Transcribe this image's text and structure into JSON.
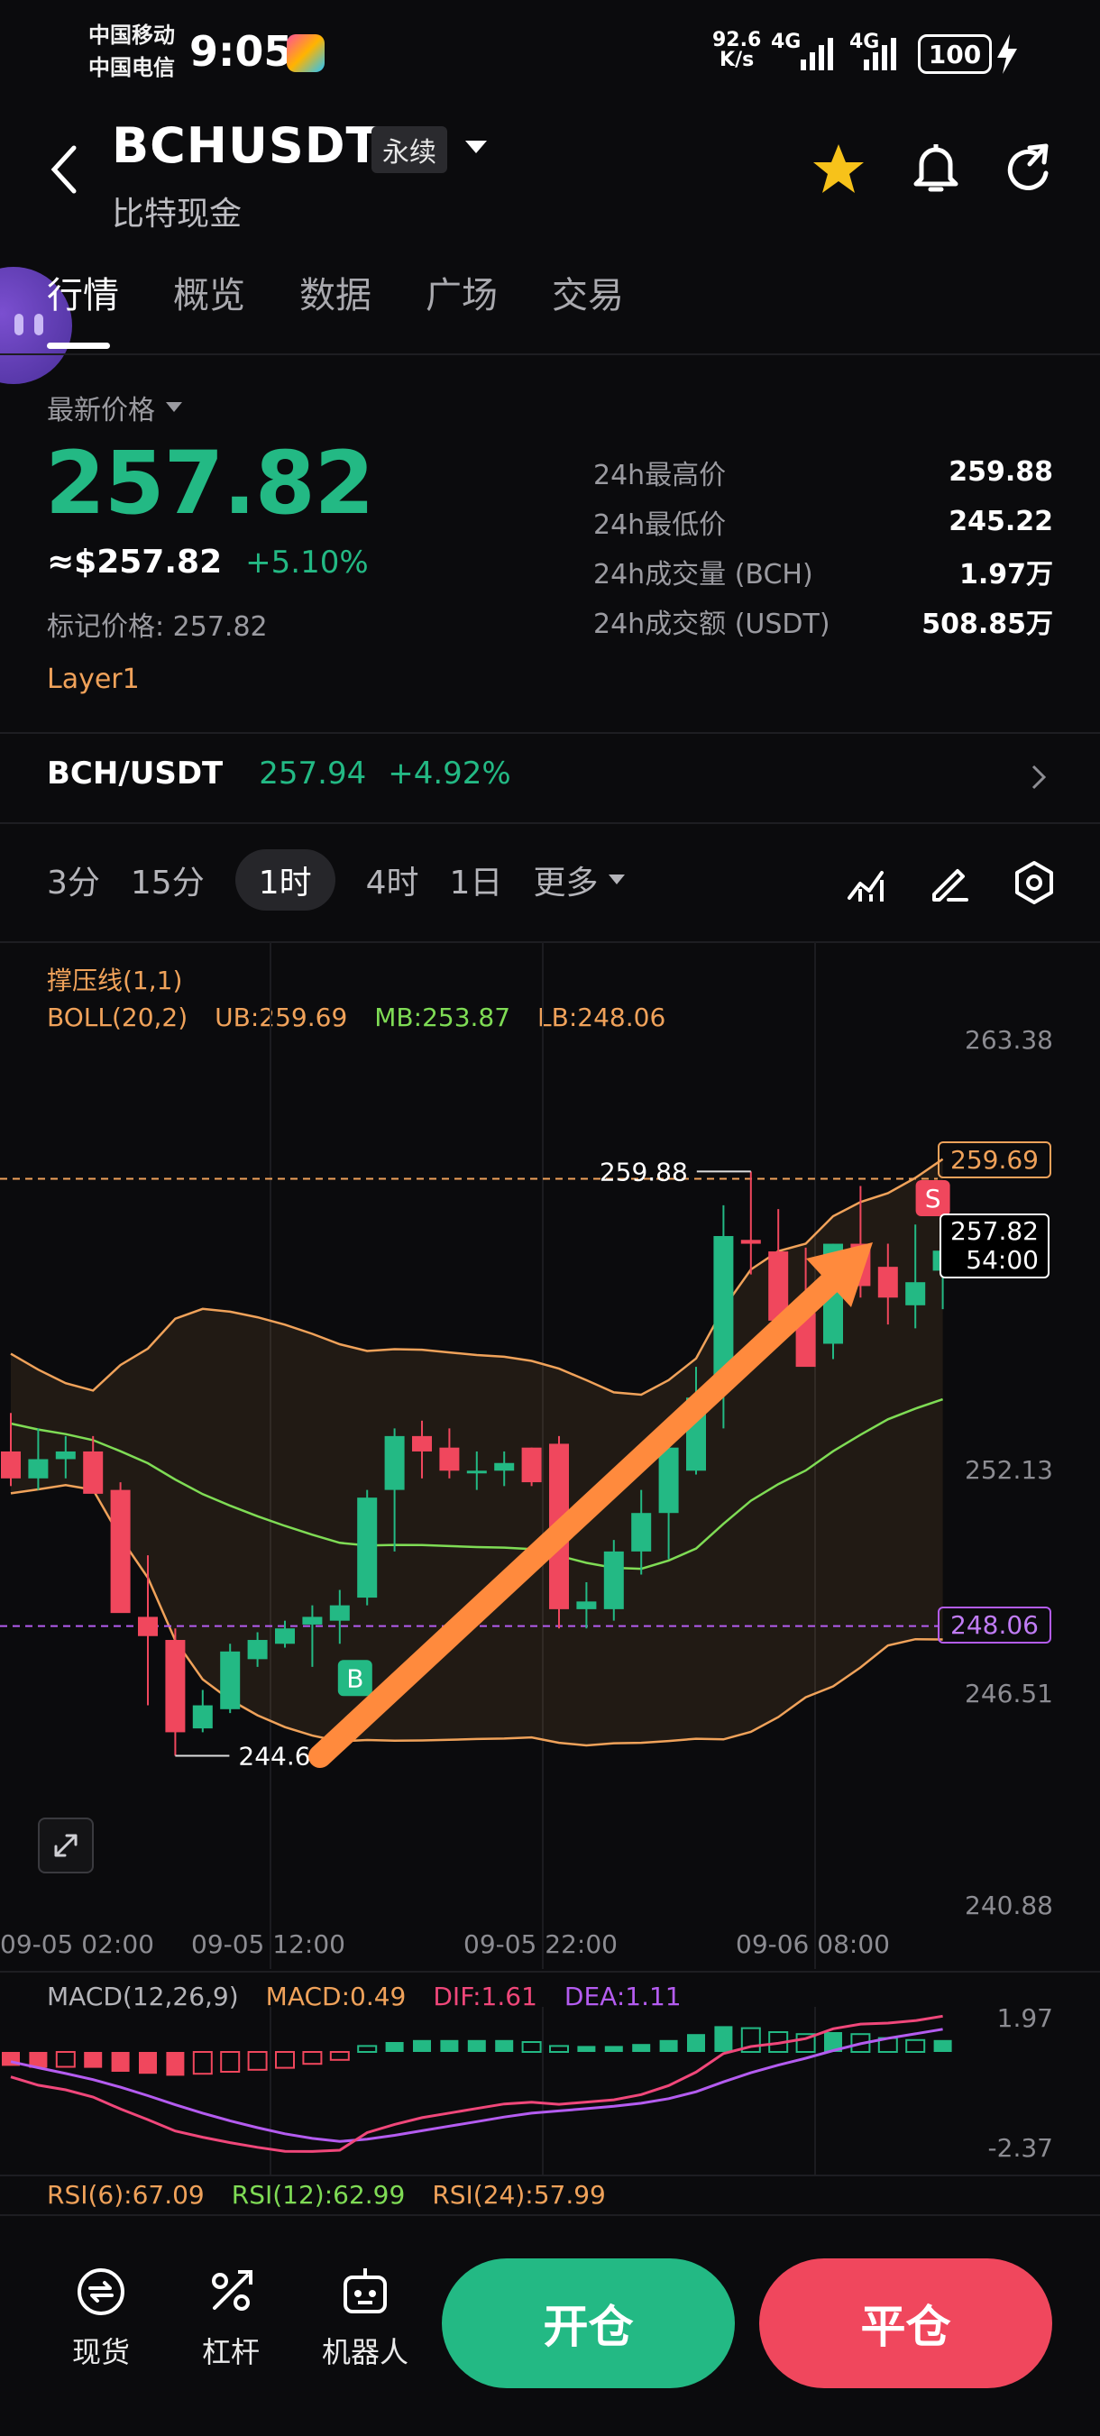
{
  "status_bar": {
    "carrier_1": "中国移动",
    "carrier_2": "中国电信",
    "time": "9:05",
    "net_speed_value": "92.6",
    "net_speed_unit": "K/s",
    "signal_1": "4G",
    "signal_2": "4G",
    "battery": "100"
  },
  "header": {
    "symbol": "BCHUSDT",
    "contract_type": "永续",
    "name": "比特现金"
  },
  "tabs": [
    {
      "label": "行情"
    },
    {
      "label": "概览"
    },
    {
      "label": "数据"
    },
    {
      "label": "广场"
    },
    {
      "label": "交易"
    }
  ],
  "price": {
    "label": "最新价格",
    "last": "257.82",
    "usd": "≈$257.82",
    "change": "+5.10%",
    "mark": "标记价格: 257.82",
    "tag": "Layer1"
  },
  "stats": [
    {
      "label": "24h最高价",
      "value": "259.88"
    },
    {
      "label": "24h最低价",
      "value": "245.22"
    },
    {
      "label": "24h成交量 (BCH)",
      "value": "1.97万"
    },
    {
      "label": "24h成交额 (USDT)",
      "value": "508.85万"
    }
  ],
  "spot": {
    "pair": "BCH/USDT",
    "price": "257.94",
    "change": "+4.92%"
  },
  "timeframes": [
    {
      "label": "3分"
    },
    {
      "label": "15分"
    },
    {
      "label": "1时"
    },
    {
      "label": "4时"
    },
    {
      "label": "1日"
    }
  ],
  "more_label": "更多",
  "indicators": {
    "sr_line": "撑压线(1,1)",
    "boll": "BOLL(20,2)",
    "ub": "UB:259.69",
    "mb": "MB:253.87",
    "lb": "LB:248.06",
    "macd_name": "MACD(12,26,9)",
    "macd": "MACD:0.49",
    "dif": "DIF:1.61",
    "dea": "DEA:1.11",
    "rsi6": "RSI(6):67.09",
    "rsi12": "RSI(12):62.99",
    "rsi24": "RSI(24):57.99"
  },
  "chart_data": {
    "type": "candlestick",
    "price_axis": [
      "263.38",
      "252.13",
      "246.51",
      "240.88"
    ],
    "price_range": [
      240.88,
      263.38
    ],
    "time_axis": [
      "09-05 02:00",
      "09-05 12:00",
      "09-05 22:00",
      "09-06 08:00"
    ],
    "high_label": "259.88",
    "low_label": "244.69",
    "ub_tag": "259.69",
    "lb_tag": "248.06",
    "current_price_tag": "257.82",
    "countdown": "54:00",
    "buy_marker": "B",
    "sell_marker": "S",
    "candles": [
      [
        252.6,
        253.6,
        251.7,
        251.9
      ],
      [
        251.9,
        253.2,
        251.6,
        252.4
      ],
      [
        252.4,
        253.0,
        251.9,
        252.6
      ],
      [
        252.6,
        253.0,
        251.6,
        251.5
      ],
      [
        251.6,
        251.8,
        248.8,
        248.4
      ],
      [
        248.3,
        249.9,
        246.0,
        247.8
      ],
      [
        247.7,
        248.0,
        244.69,
        245.3
      ],
      [
        245.4,
        246.4,
        245.3,
        246.0
      ],
      [
        245.9,
        247.6,
        245.8,
        247.4
      ],
      [
        247.2,
        247.9,
        247.0,
        247.7
      ],
      [
        247.6,
        248.2,
        247.5,
        248.0
      ],
      [
        248.1,
        248.6,
        247.0,
        248.3
      ],
      [
        248.2,
        249.0,
        247.6,
        248.6
      ],
      [
        248.8,
        251.6,
        248.6,
        251.4
      ],
      [
        251.6,
        253.2,
        250.0,
        253.0
      ],
      [
        253.0,
        253.4,
        251.9,
        252.6
      ],
      [
        252.7,
        253.2,
        251.9,
        252.1
      ],
      [
        252.1,
        252.6,
        251.6,
        252.1
      ],
      [
        252.1,
        252.6,
        251.7,
        252.3
      ],
      [
        252.7,
        252.7,
        251.7,
        251.8
      ],
      [
        252.8,
        253.0,
        248.0,
        248.5
      ],
      [
        248.5,
        249.2,
        248.0,
        248.7
      ],
      [
        248.5,
        250.3,
        248.2,
        250.0
      ],
      [
        250.0,
        251.6,
        249.4,
        251.0
      ],
      [
        251.0,
        252.9,
        249.8,
        252.7
      ],
      [
        252.1,
        254.8,
        252.0,
        254.0
      ],
      [
        254.4,
        259.0,
        253.2,
        258.2
      ],
      [
        258.1,
        259.88,
        257.2,
        258.0
      ],
      [
        257.8,
        258.9,
        255.6,
        256.0
      ],
      [
        256.2,
        257.9,
        255.0,
        254.8
      ],
      [
        255.4,
        258.0,
        255.0,
        258.0
      ],
      [
        258.0,
        259.5,
        256.6,
        256.9
      ],
      [
        257.4,
        258.0,
        255.9,
        256.6
      ],
      [
        256.4,
        258.5,
        255.8,
        257.0
      ],
      [
        257.3,
        258.2,
        256.3,
        257.82
      ]
    ],
    "macd_axis": [
      "1.97",
      "-2.37"
    ],
    "macd_hist": [
      -0.7,
      -0.8,
      -0.75,
      -0.8,
      -1.0,
      -1.1,
      -1.2,
      -1.1,
      -1.0,
      -0.9,
      -0.8,
      -0.6,
      -0.4,
      0.3,
      0.5,
      0.6,
      0.6,
      0.6,
      0.6,
      0.5,
      0.3,
      0.3,
      0.3,
      0.4,
      0.6,
      0.9,
      1.3,
      1.2,
      1.0,
      0.9,
      1.0,
      0.9,
      0.7,
      0.6,
      0.6
    ]
  },
  "bottom_bar": {
    "spot": "现货",
    "leverage": "杠杆",
    "robot": "机器人",
    "open": "开仓",
    "close": "平仓"
  }
}
